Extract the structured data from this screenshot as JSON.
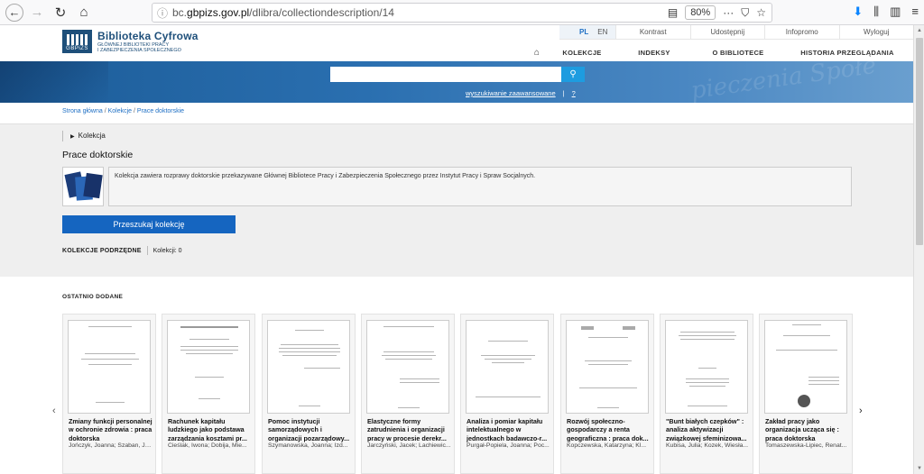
{
  "browser": {
    "url_prefix": "bc.",
    "url_domain": "gbpizs.gov.pl",
    "url_path": "/dlibra/collectiondescription/14",
    "zoom": "80%",
    "more_icon": "···"
  },
  "logo": {
    "mark_text": "GBPiZS",
    "title": "Biblioteka Cyfrowa",
    "subtitle_line1": "GŁÓWNEJ BIBLIOTEKI PRACY",
    "subtitle_line2": "I ZABEZPIECZENIA SPOŁECZNEGO"
  },
  "top_links": {
    "lang_pl": "PL",
    "lang_en": "EN",
    "contrast": "Kontrast",
    "share": "Udostępnij",
    "infopromo": "Infopromo",
    "logout": "Wyloguj"
  },
  "main_nav": {
    "collections": "KOLEKCJE",
    "indexes": "INDEKSY",
    "about": "O BIBLIOTECE",
    "history": "HISTORIA PRZEGLĄDANIA"
  },
  "search": {
    "placeholder": "",
    "advanced_link": "wyszukiwanie zaawansowane",
    "separator": "|",
    "help": "?"
  },
  "breadcrumb": {
    "home": "Strona główna",
    "collections": "Kolekcje",
    "current": "Prace doktorskie",
    "sep": " / "
  },
  "collection": {
    "label": "Kolekcja",
    "title": "Prace doktorskie",
    "description": "Kolekcja zawiera rozprawy doktorskie przekazywane Głównej Bibliotece Pracy i Zabezpieczenia Społecznego przez Instytut Pracy i Spraw Socjalnych.",
    "search_button": "Przeszukaj kolekcję",
    "sub_label": "KOLEKCJE PODRZĘDNE",
    "sub_count": "Kolekcji: 0"
  },
  "recent": {
    "heading": "OSTATNIO DODANE",
    "prev": "‹",
    "next": "›",
    "items": [
      {
        "title": "Zmiany funkcji personalnej w ochronie zdrowia : praca doktorska",
        "authors": "Jończyk, Joanna; Szaban, Jol..."
      },
      {
        "title": "Rachunek kapitału ludzkiego jako podstawa zarządzania kosztami pr...",
        "authors": "Cieślak, Iwona; Dobija, Mie..."
      },
      {
        "title": "Pomoc instytucji samorządowych i organizacji pozarządowy...",
        "authors": "Szymanowska, Joanna; Izd..."
      },
      {
        "title": "Elastyczne formy zatrudnienia i organizacji pracy w procesie derekr...",
        "authors": "Jarczyński, Jacek; Lachiewic..."
      },
      {
        "title": "Analiza i pomiar kapitału intelektualnego w jednostkach badawczo-r...",
        "authors": "Purgał-Popiela, Joanna; Poc..."
      },
      {
        "title": "Rozwój społeczno-gospodarczy a renta geograficzna : praca dok...",
        "authors": "Kopczewska, Katarzyna; Kl..."
      },
      {
        "title": "\"Bunt białych czepków\" : analiza aktywizacji związkowej sfeminizowa...",
        "authors": "Kubisa, Julia; Kozek, Wiesła..."
      },
      {
        "title": "Zakład pracy jako organizacja ucząca się : praca doktorska",
        "authors": "Tomaszewska-Lipiec, Renat..."
      }
    ]
  }
}
